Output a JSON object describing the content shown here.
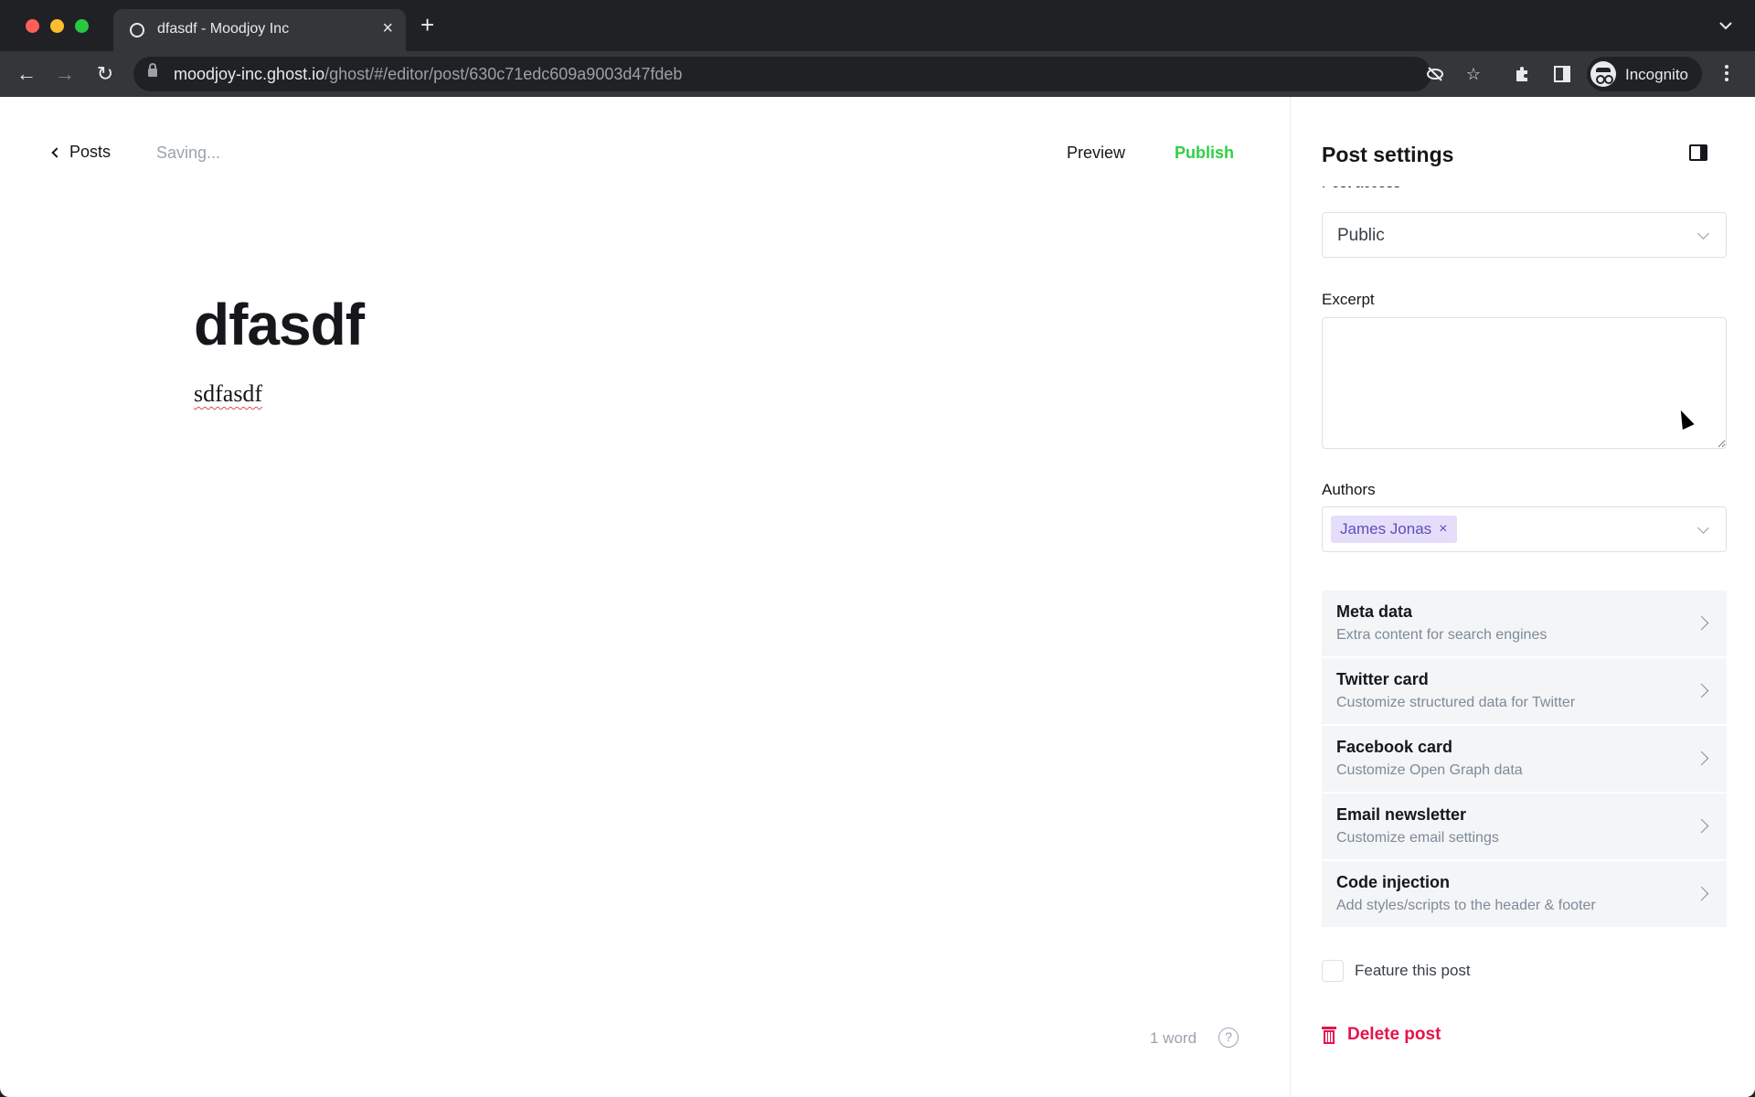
{
  "browser": {
    "tab_title": "dfasdf - Moodjoy Inc",
    "url_host": "moodjoy-inc.ghost.io",
    "url_path": "/ghost/#/editor/post/630c71edc609a9003d47fdeb",
    "profile_label": "Incognito"
  },
  "editor": {
    "back_label": "Posts",
    "status": "Saving...",
    "preview_label": "Preview",
    "publish_label": "Publish",
    "post_title": "dfasdf",
    "post_body": "sdfasdf",
    "word_count": "1 word",
    "help_glyph": "?"
  },
  "settings": {
    "title": "Post settings",
    "access_label": "Post access",
    "access_value": "Public",
    "excerpt_label": "Excerpt",
    "excerpt_value": "",
    "authors_label": "Authors",
    "authors": [
      "James Jonas"
    ],
    "sections": [
      {
        "title": "Meta data",
        "subtitle": "Extra content for search engines"
      },
      {
        "title": "Twitter card",
        "subtitle": "Customize structured data for Twitter"
      },
      {
        "title": "Facebook card",
        "subtitle": "Customize Open Graph data"
      },
      {
        "title": "Email newsletter",
        "subtitle": "Customize email settings"
      },
      {
        "title": "Code injection",
        "subtitle": "Add styles/scripts to the header & footer"
      }
    ],
    "feature_label": "Feature this post",
    "feature_checked": false,
    "delete_label": "Delete post"
  },
  "colors": {
    "publish": "#30cf43",
    "delete": "#e5124b",
    "author_chip_bg": "#e5defb",
    "author_chip_text": "#5e4eb8"
  }
}
